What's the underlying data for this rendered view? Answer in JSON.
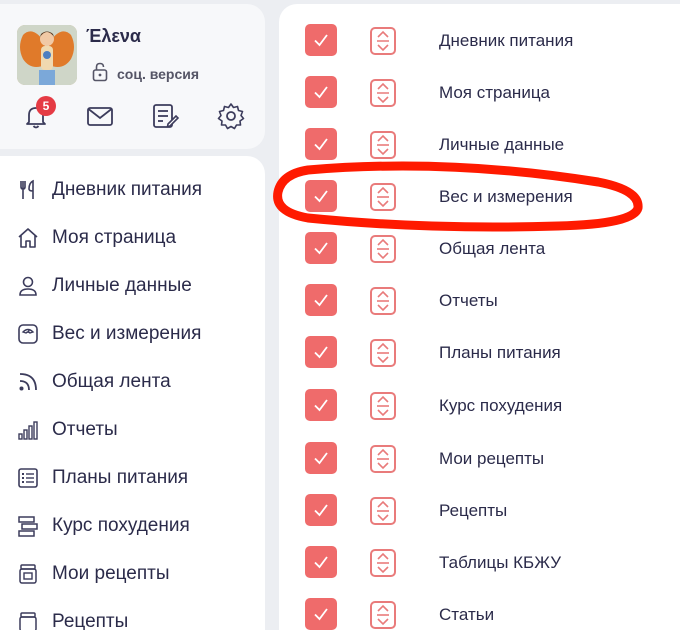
{
  "profile": {
    "name": "Έλενα",
    "version": "соц. версия",
    "notifications_count": "5"
  },
  "colors": {
    "accent": "#ef6b6b",
    "highlight": "#ff1a00",
    "badge": "#e53b44"
  },
  "sidebar": {
    "items": [
      {
        "label": "Дневник питания",
        "icon": "fork-knife-icon"
      },
      {
        "label": "Моя страница",
        "icon": "home-icon"
      },
      {
        "label": "Личные данные",
        "icon": "user-icon"
      },
      {
        "label": "Вес и измерения",
        "icon": "scale-icon"
      },
      {
        "label": "Общая лента",
        "icon": "feed-icon"
      },
      {
        "label": "Отчеты",
        "icon": "chart-icon"
      },
      {
        "label": "Планы питания",
        "icon": "list-icon"
      },
      {
        "label": "Курс похудения",
        "icon": "course-icon"
      },
      {
        "label": "Мои рецепты",
        "icon": "recipe-jar-icon"
      },
      {
        "label": "Рецепты",
        "icon": "recipe-icon"
      }
    ]
  },
  "menu_settings": {
    "rows": [
      {
        "label": "Дневник питания",
        "checked": true
      },
      {
        "label": "Моя страница",
        "checked": true
      },
      {
        "label": "Личные данные",
        "checked": true
      },
      {
        "label": "Вес и измерения",
        "checked": true
      },
      {
        "label": "Общая лента",
        "checked": true
      },
      {
        "label": "Отчеты",
        "checked": true
      },
      {
        "label": "Планы питания",
        "checked": true
      },
      {
        "label": "Курс похудения",
        "checked": true
      },
      {
        "label": "Мои рецепты",
        "checked": true
      },
      {
        "label": "Рецепты",
        "checked": true
      },
      {
        "label": "Таблицы КБЖУ",
        "checked": true
      },
      {
        "label": "Статьи",
        "checked": true
      }
    ]
  }
}
